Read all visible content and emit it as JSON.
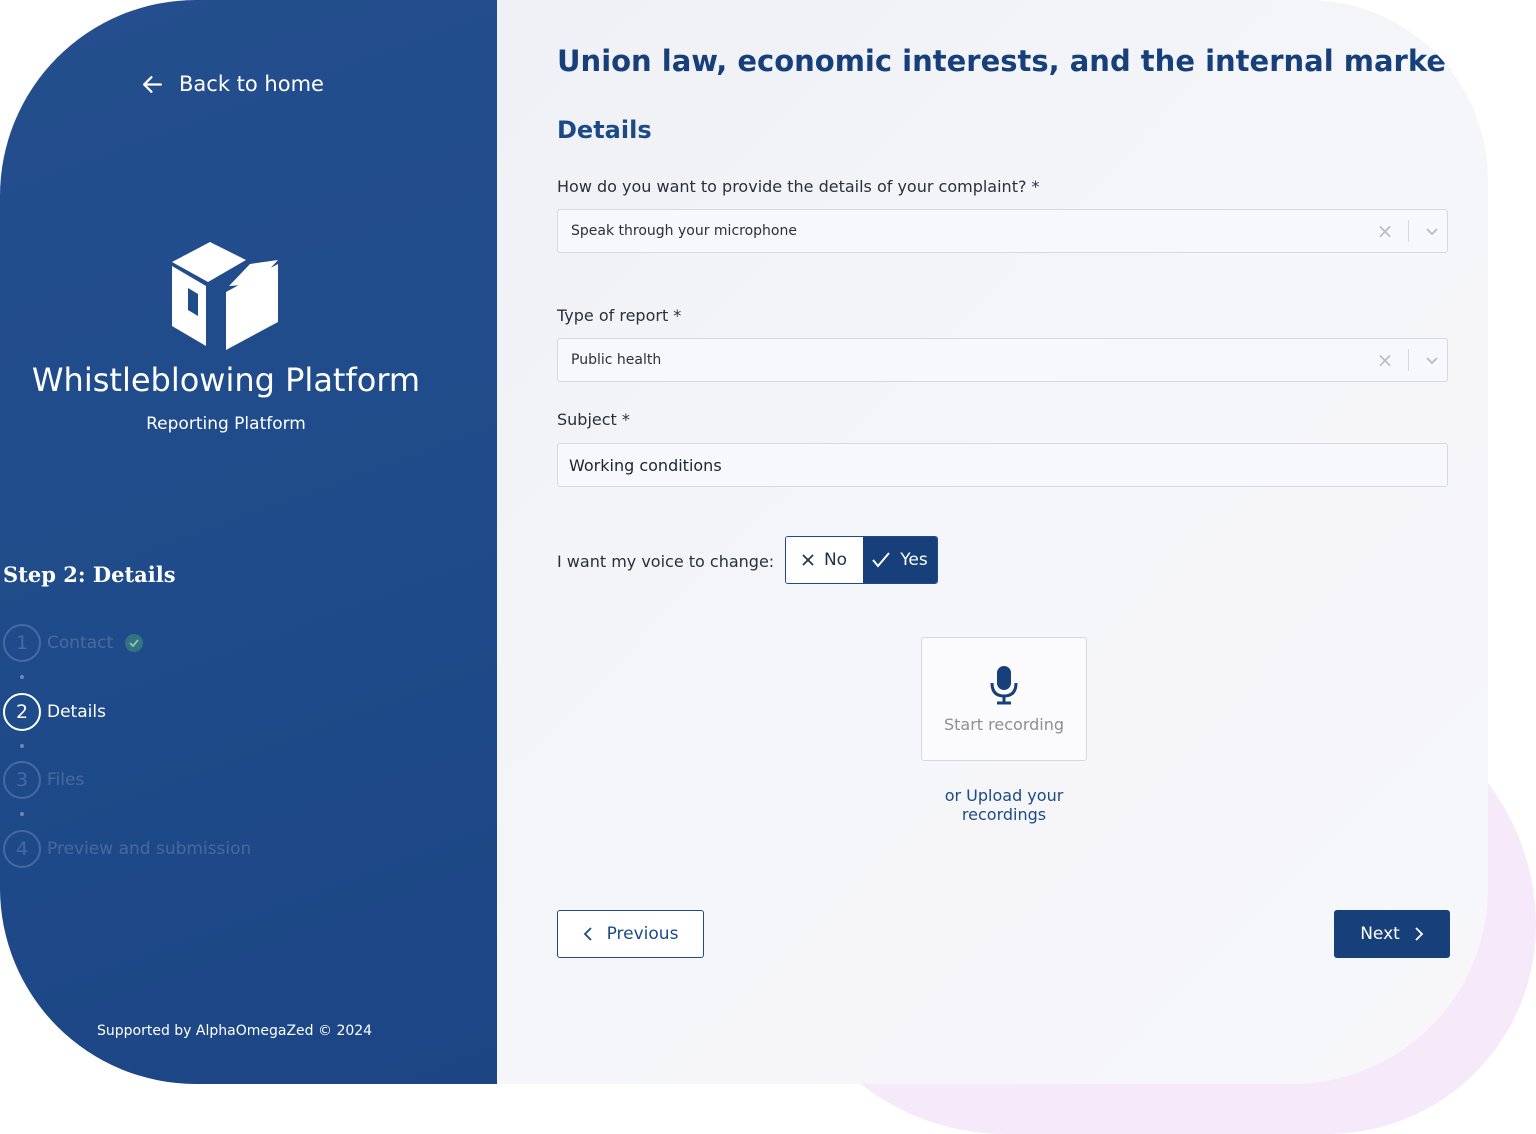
{
  "sidebar": {
    "back_label": "Back to home",
    "platform_name": "Whistleblowing Platform",
    "platform_subtitle": "Reporting Platform",
    "step_title": "Step 2: Details",
    "steps": [
      {
        "number": "1",
        "label": "Contact",
        "state": "completed"
      },
      {
        "number": "2",
        "label": "Details",
        "state": "active"
      },
      {
        "number": "3",
        "label": "Files",
        "state": "upcoming"
      },
      {
        "number": "4",
        "label": "Preview and submission",
        "state": "upcoming"
      }
    ],
    "supported_by": "Supported by AlphaOmegaZed © 2024"
  },
  "main": {
    "title": "Union law, economic interests, and the internal market",
    "section_title": "Details",
    "method_label": "How do you want to provide the details of your complaint? *",
    "method_value": "Speak through your microphone",
    "report_type_label": "Type of report *",
    "report_type_value": "Public health",
    "subject_label": "Subject *",
    "subject_value": "Working conditions",
    "voice_change_label": "I want my voice to change:",
    "voice_no_label": "No",
    "voice_yes_label": "Yes",
    "voice_change_selected": "Yes",
    "start_recording_label": "Start recording",
    "upload_label": "or Upload your recordings",
    "previous_label": "Previous",
    "next_label": "Next"
  },
  "colors": {
    "sidebar_bg": "#1f4b8a",
    "primary": "#173f7a",
    "heading": "#1c4a87",
    "page_bg": "#f3f4f8",
    "accent_blob": "#f6eafa"
  },
  "icons": {
    "back": "arrow-left-icon",
    "logo": "box-icon",
    "completed": "check-circle-icon",
    "clear": "close-icon",
    "dropdown": "chevron-down-icon",
    "no": "close-icon",
    "yes": "check-icon",
    "recording": "microphone-icon",
    "previous": "chevron-left-icon",
    "next": "chevron-right-icon"
  }
}
